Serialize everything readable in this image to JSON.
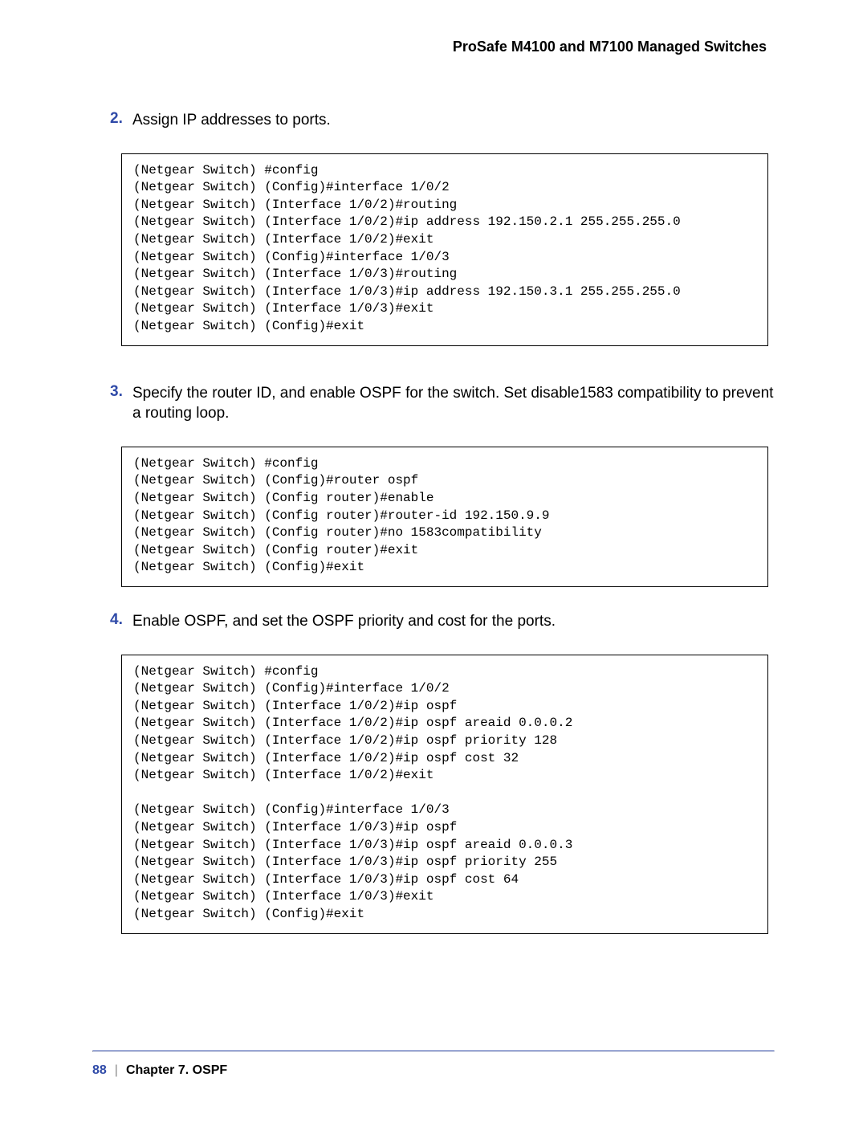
{
  "header": {
    "title": "ProSafe M4100 and M7100 Managed Switches"
  },
  "steps": [
    {
      "num": "2.",
      "text": "Assign IP addresses to ports.",
      "code": "(Netgear Switch) #config\n(Netgear Switch) (Config)#interface 1/0/2\n(Netgear Switch) (Interface 1/0/2)#routing\n(Netgear Switch) (Interface 1/0/2)#ip address 192.150.2.1 255.255.255.0\n(Netgear Switch) (Interface 1/0/2)#exit\n(Netgear Switch) (Config)#interface 1/0/3\n(Netgear Switch) (Interface 1/0/3)#routing\n(Netgear Switch) (Interface 1/0/3)#ip address 192.150.3.1 255.255.255.0\n(Netgear Switch) (Interface 1/0/3)#exit\n(Netgear Switch) (Config)#exit"
    },
    {
      "num": "3.",
      "text": "Specify the router ID, and enable OSPF for the switch. Set disable1583 compatibility to prevent a routing loop.",
      "code": "(Netgear Switch) #config\n(Netgear Switch) (Config)#router ospf\n(Netgear Switch) (Config router)#enable\n(Netgear Switch) (Config router)#router-id 192.150.9.9\n(Netgear Switch) (Config router)#no 1583compatibility\n(Netgear Switch) (Config router)#exit\n(Netgear Switch) (Config)#exit"
    },
    {
      "num": "4.",
      "text": "Enable OSPF, and set the OSPF priority and cost for the ports.",
      "code": "(Netgear Switch) #config\n(Netgear Switch) (Config)#interface 1/0/2\n(Netgear Switch) (Interface 1/0/2)#ip ospf\n(Netgear Switch) (Interface 1/0/2)#ip ospf areaid 0.0.0.2\n(Netgear Switch) (Interface 1/0/2)#ip ospf priority 128\n(Netgear Switch) (Interface 1/0/2)#ip ospf cost 32\n(Netgear Switch) (Interface 1/0/2)#exit\n\n(Netgear Switch) (Config)#interface 1/0/3\n(Netgear Switch) (Interface 1/0/3)#ip ospf\n(Netgear Switch) (Interface 1/0/3)#ip ospf areaid 0.0.0.3\n(Netgear Switch) (Interface 1/0/3)#ip ospf priority 255\n(Netgear Switch) (Interface 1/0/3)#ip ospf cost 64\n(Netgear Switch) (Interface 1/0/3)#exit\n(Netgear Switch) (Config)#exit"
    }
  ],
  "footer": {
    "page_num": "88",
    "separator": "|",
    "chapter": "Chapter 7.  OSPF"
  }
}
